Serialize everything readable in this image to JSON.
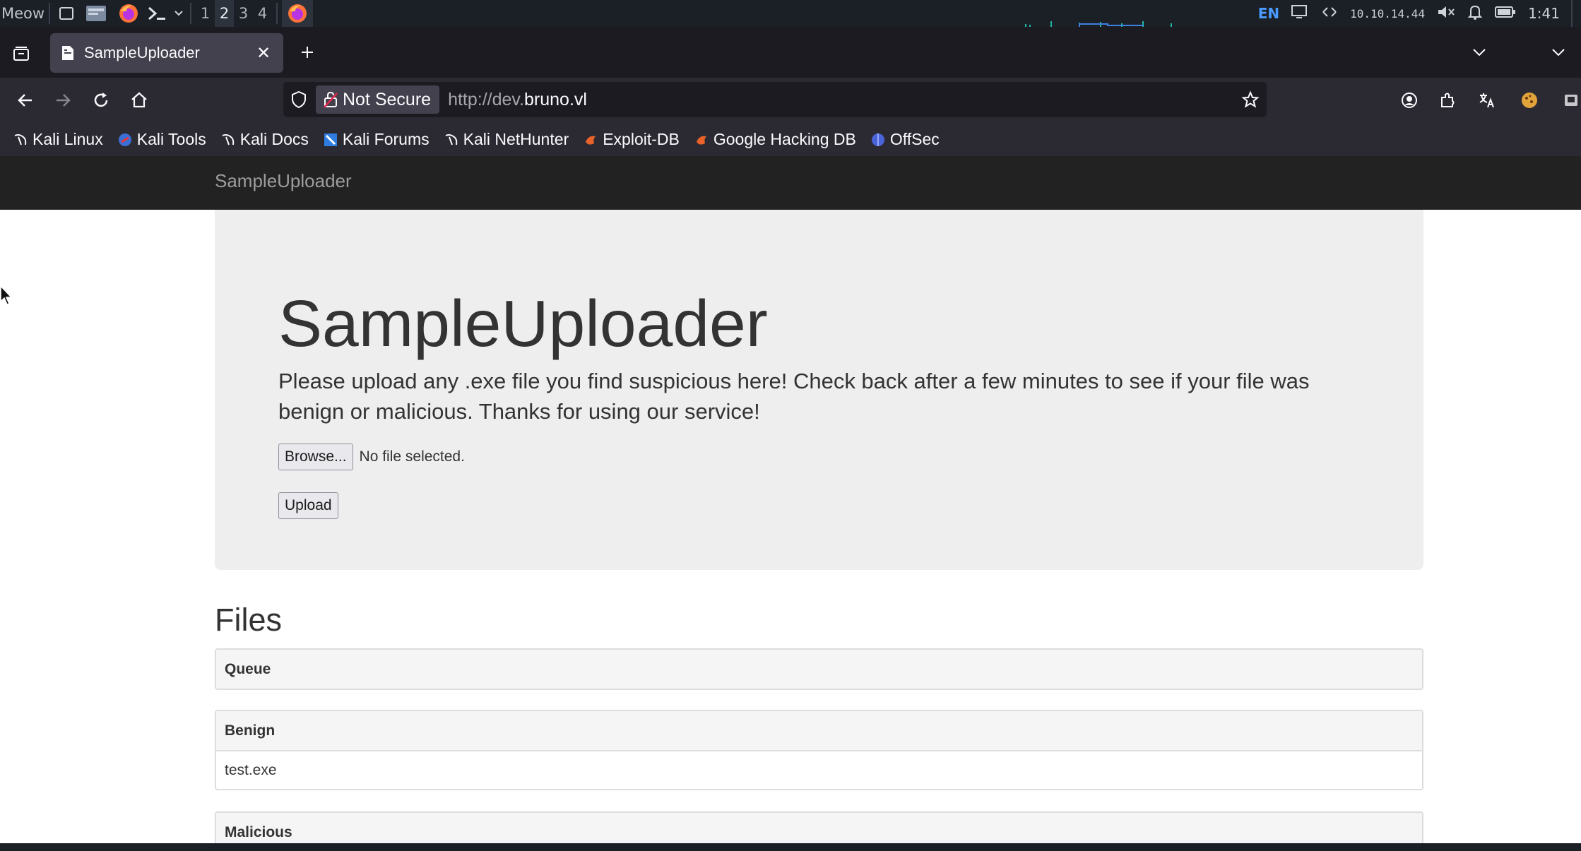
{
  "desktop": {
    "menu_label": "Meow",
    "workspaces": [
      "1",
      "2",
      "3",
      "4"
    ],
    "active_workspace": "2",
    "language": "EN",
    "ip_address": "10.10.14.44",
    "clock": "1:41"
  },
  "browser": {
    "tab_title": "SampleUploader",
    "security_label": "Not Secure",
    "url_scheme": "http://dev.",
    "url_host": "bruno.vl",
    "bookmarks": [
      "Kali Linux",
      "Kali Tools",
      "Kali Docs",
      "Kali Forums",
      "Kali NetHunter",
      "Exploit-DB",
      "Google Hacking DB",
      "OffSec"
    ]
  },
  "page": {
    "brand": "SampleUploader",
    "heading": "SampleUploader",
    "description": "Please upload any .exe file you find suspicious here! Check back after a few minutes to see if your file was benign or malicious. Thanks for using our service!",
    "browse_label": "Browse...",
    "no_file_text": "No file selected.",
    "upload_label": "Upload",
    "files_heading": "Files",
    "queue_label": "Queue",
    "benign_label": "Benign",
    "benign_files": [
      "test.exe"
    ],
    "malicious_label": "Malicious"
  },
  "colors": {
    "page_nav": "#222222",
    "jumbotron": "#eeeeee",
    "browser_toolbar": "#2b2a33"
  }
}
